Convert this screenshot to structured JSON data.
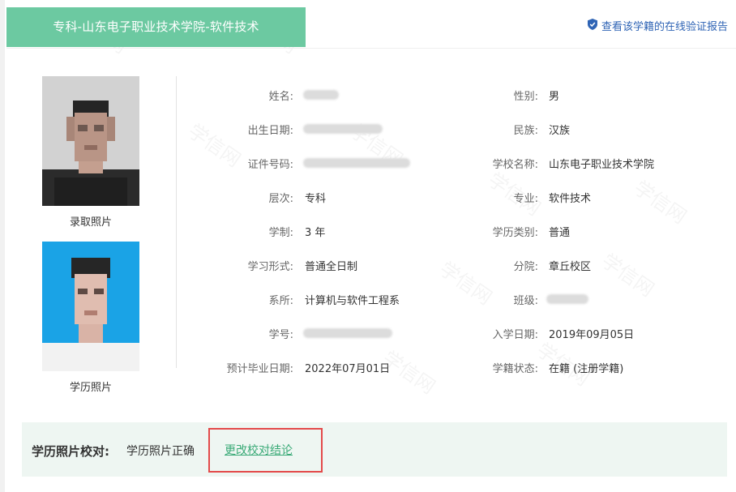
{
  "header": {
    "title": "专科-山东电子职业技术学院-软件技术",
    "verify_link": "查看该学籍的在线验证报告"
  },
  "photos": {
    "admission_caption": "录取照片",
    "degree_caption": "学历照片"
  },
  "fields": {
    "name_label": "姓名:",
    "gender_label": "性别:",
    "gender_value": "男",
    "birth_label": "出生日期:",
    "ethnicity_label": "民族:",
    "ethnicity_value": "汉族",
    "id_label": "证件号码:",
    "school_label": "学校名称:",
    "school_value": "山东电子职业技术学院",
    "level_label": "层次:",
    "level_value": "专科",
    "major_label": "专业:",
    "major_value": "软件技术",
    "duration_label": "学制:",
    "duration_value": "3 年",
    "edu_type_label": "学历类别:",
    "edu_type_value": "普通",
    "study_form_label": "学习形式:",
    "study_form_value": "普通全日制",
    "branch_label": "分院:",
    "branch_value": "章丘校区",
    "dept_label": "系所:",
    "dept_value": "计算机与软件工程系",
    "class_label": "班级:",
    "student_no_label": "学号:",
    "enroll_date_label": "入学日期:",
    "enroll_date_value": "2019年09月05日",
    "grad_date_label": "预计毕业日期:",
    "grad_date_value": "2022年07月01日",
    "status_label": "学籍状态:",
    "status_value": "在籍 (注册学籍)"
  },
  "photo_check": {
    "label": "学历照片校对:",
    "value": "学历照片正确",
    "change_link": "更改校对结论"
  },
  "watermark": "学信网",
  "colors": {
    "header_green": "#6cc9a1",
    "link_blue": "#2f64b5",
    "link_green": "#3aaa77",
    "highlight_red": "#e34a4a",
    "check_bg": "#eef6f2"
  }
}
